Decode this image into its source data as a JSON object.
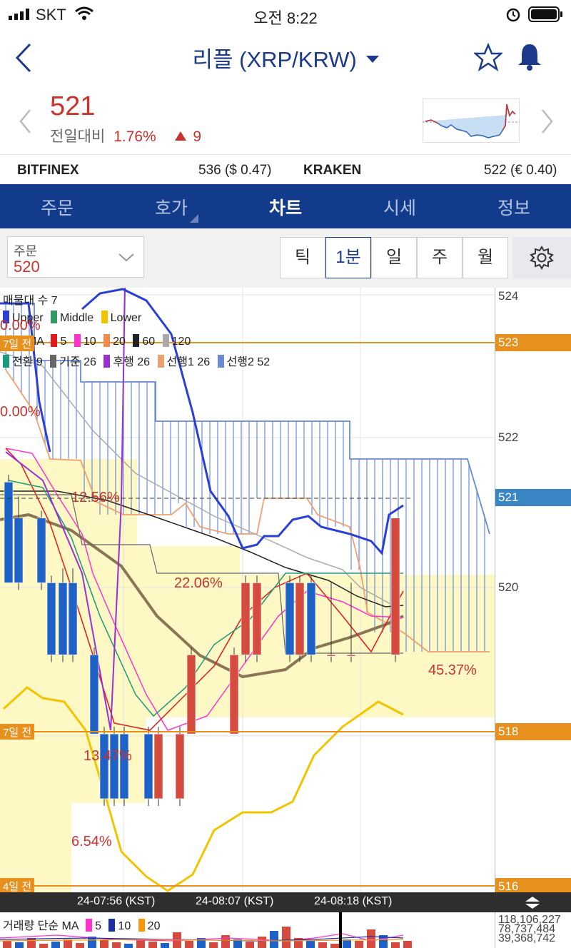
{
  "status": {
    "carrier": "SKT",
    "time": "오전 8:22"
  },
  "header": {
    "title": "리플 (XRP/KRW)"
  },
  "ticker": {
    "price": "521",
    "change_label": "전일대비",
    "change_pct": "1.76%",
    "change_amt": "9"
  },
  "exchanges": [
    {
      "name": "BITFINEX",
      "value": "536 ($ 0.47)"
    },
    {
      "name": "KRAKEN",
      "value": "522 (€ 0.40)"
    }
  ],
  "tabs": [
    "주문",
    "호가",
    "차트",
    "시세",
    "정보"
  ],
  "active_tab": "차트",
  "order_box": {
    "label": "주문",
    "value": "520"
  },
  "intervals": [
    "틱",
    "1분",
    "일",
    "주",
    "월"
  ],
  "active_interval": "1분",
  "legend": {
    "title": "매물대 수 7",
    "bollinger": [
      {
        "name": "Upper",
        "color": "#2a3fd6"
      },
      {
        "name": "Middle",
        "color": "#2f9a62"
      },
      {
        "name": "Lower",
        "color": "#f2c400"
      }
    ],
    "ma_label": "단순 MA",
    "ma": [
      {
        "name": "5",
        "color": "#e31a1c"
      },
      {
        "name": "10",
        "color": "#ff33cc"
      },
      {
        "name": "20",
        "color": "#f4894d"
      },
      {
        "name": "60",
        "color": "#222222"
      },
      {
        "name": "120",
        "color": "#aaaaaa"
      }
    ],
    "ichimoku": [
      {
        "name": "전환 9",
        "color": "#1a9a7a"
      },
      {
        "name": "기준 26",
        "color": "#666666"
      },
      {
        "name": "후행 26",
        "color": "#9b2fd6"
      },
      {
        "name": "선행1 26",
        "color": "#f0a070"
      },
      {
        "name": "선행2 52",
        "color": "#6a8ad8"
      }
    ]
  },
  "volume_profile_pct": [
    "0.00%",
    "0.00%",
    "12.56%",
    "22.06%",
    "45.37%",
    "13.47%",
    "6.54%"
  ],
  "days_ago": [
    "7일 전",
    "7일 전",
    "4일 전"
  ],
  "y_ticks": [
    "524",
    "522",
    "520"
  ],
  "y_badges": [
    {
      "label": "523",
      "color": "#e8901e"
    },
    {
      "label": "521",
      "color": "#3a86c4"
    },
    {
      "label": "518",
      "color": "#e8901e"
    },
    {
      "label": "516",
      "color": "#e8901e"
    }
  ],
  "time_labels": [
    "24-07:56 (KST)",
    "24-08:07 (KST)",
    "24-08:18 (KST)"
  ],
  "volume": {
    "ma_label": "거래량 단순 MA",
    "ma": [
      {
        "name": "5",
        "color": "#ff33cc"
      },
      {
        "name": "10",
        "color": "#1b2ea8"
      },
      {
        "name": "20",
        "color": "#f59a10"
      }
    ],
    "readouts": [
      "118,106,227",
      "78,737,484",
      "39,368,742"
    ]
  },
  "chart_data": {
    "type": "candlestick",
    "y_range": [
      515.8,
      524.2
    ],
    "candles": [
      {
        "o": 521.5,
        "c": 520.1,
        "h": 521.6,
        "l": 520.1
      },
      {
        "o": 521.0,
        "c": 520.1,
        "h": 521.3,
        "l": 520.0
      },
      {
        "o": 521.0,
        "c": 520.1,
        "h": 521.1,
        "l": 520.0
      },
      {
        "o": 520.1,
        "c": 519.1,
        "h": 520.2,
        "l": 519.0
      },
      {
        "o": 520.1,
        "c": 519.1,
        "h": 520.3,
        "l": 519.0
      },
      {
        "o": 520.1,
        "c": 519.1,
        "h": 520.3,
        "l": 519.0
      },
      {
        "o": 519.1,
        "c": 518.0,
        "h": 519.2,
        "l": 518.0
      },
      {
        "o": 518.0,
        "c": 517.1,
        "h": 518.1,
        "l": 517.0
      },
      {
        "o": 518.0,
        "c": 517.1,
        "h": 518.1,
        "l": 517.0
      },
      {
        "o": 518.0,
        "c": 517.1,
        "h": 518.1,
        "l": 517.0
      },
      {
        "o": 518.0,
        "c": 517.1,
        "h": 518.1,
        "l": 517.0
      },
      {
        "o": 517.1,
        "c": 518.0,
        "h": 518.1,
        "l": 517.0
      },
      {
        "o": 517.1,
        "c": 518.0,
        "h": 518.1,
        "l": 517.0
      },
      {
        "o": 518.0,
        "c": 519.1,
        "h": 519.2,
        "l": 518.0
      },
      {
        "o": 518.0,
        "c": 519.1,
        "h": 519.2,
        "l": 518.0
      },
      {
        "o": 519.1,
        "c": 520.1,
        "h": 520.2,
        "l": 519.0
      },
      {
        "o": 519.1,
        "c": 520.1,
        "h": 520.2,
        "l": 519.0
      },
      {
        "o": 520.1,
        "c": 519.1,
        "h": 520.2,
        "l": 519.0
      },
      {
        "o": 519.1,
        "c": 520.1,
        "h": 520.2,
        "l": 519.0
      },
      {
        "o": 520.1,
        "c": 519.1,
        "h": 520.2,
        "l": 519.0
      },
      {
        "o": 519.1,
        "c": 519.1,
        "h": 520.1,
        "l": 519.0
      },
      {
        "o": 519.1,
        "c": 519.1,
        "h": 520.1,
        "l": 519.0
      },
      {
        "o": 519.1,
        "c": 521.0,
        "h": 521.0,
        "l": 519.0
      }
    ]
  }
}
